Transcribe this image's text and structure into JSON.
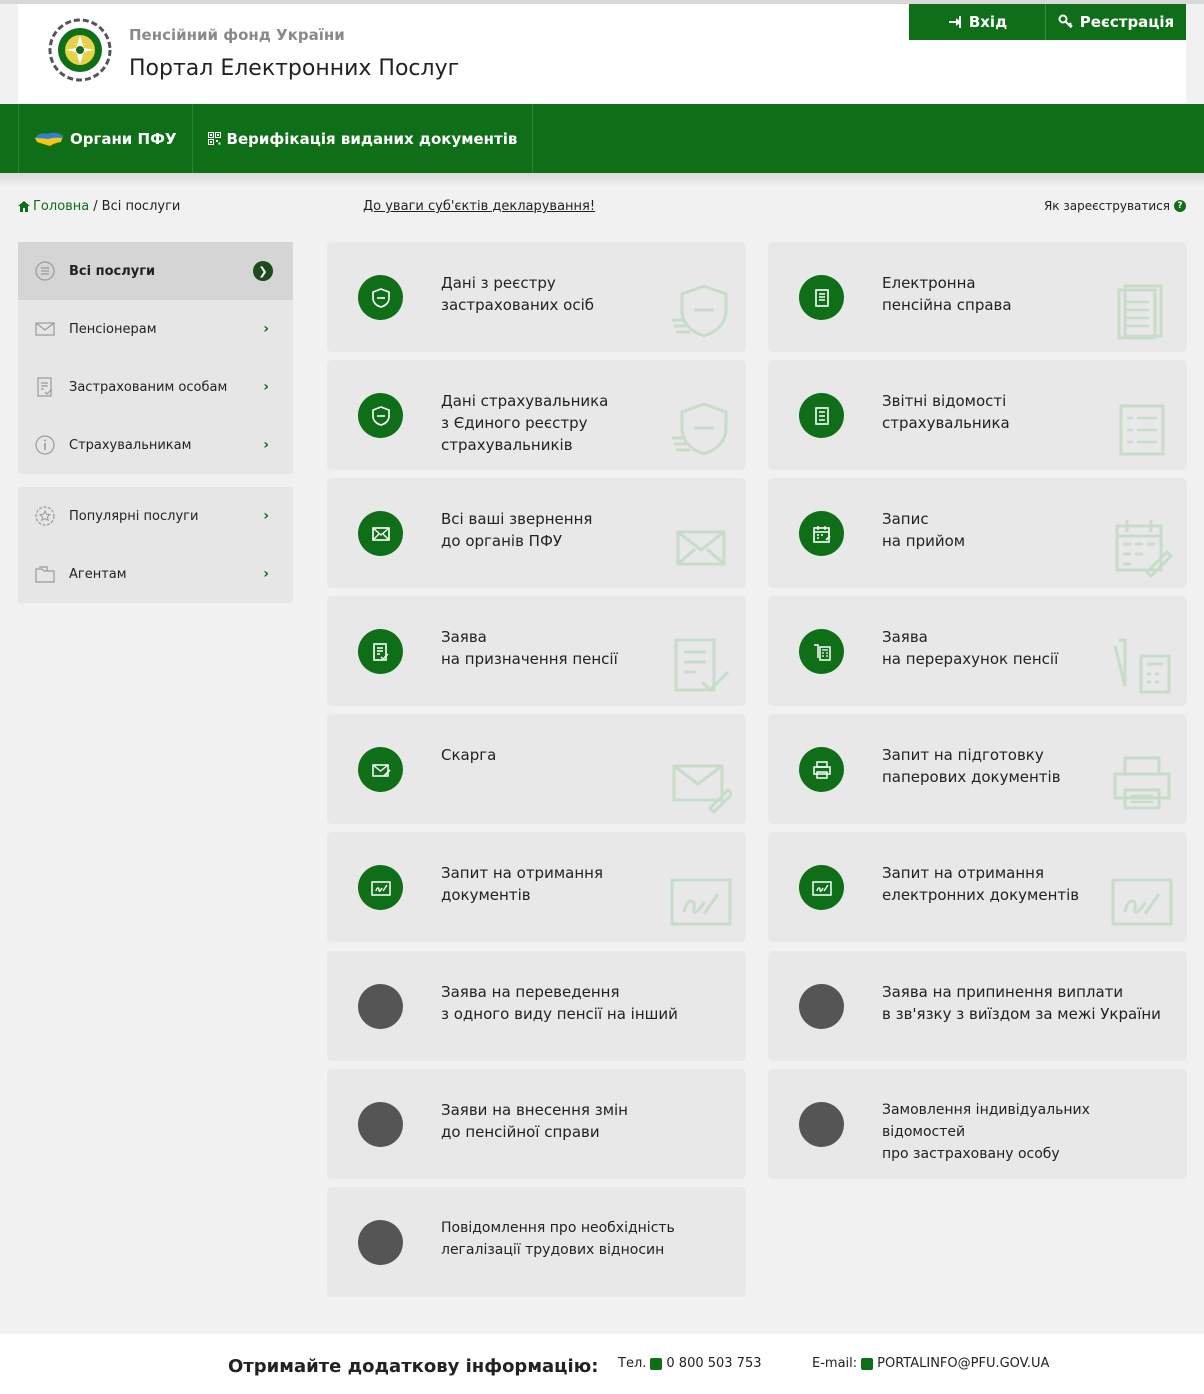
{
  "header": {
    "org_name": "Пенсійний фонд України",
    "portal_name": "Портал Електронних Послуг",
    "login_label": "Вхід",
    "register_label": "Реєстрація"
  },
  "nav": {
    "items": [
      {
        "label": "Органи ПФУ",
        "icon": "ukraine-map-icon"
      },
      {
        "label": "Верифікація виданих документів",
        "icon": "qr-code-icon"
      }
    ]
  },
  "breadcrumb": {
    "home": "Головна",
    "separator": "/",
    "current": "Всі послуги"
  },
  "notice_link": "До уваги суб'єктів декларування!",
  "how_register": "Як зареєструватися",
  "sidebar": {
    "group1": [
      {
        "label": "Всі послуги",
        "icon": "list-icon",
        "active": true
      },
      {
        "label": "Пенсіонерам",
        "icon": "envelope-icon"
      },
      {
        "label": "Застрахованим особам",
        "icon": "document-check-icon"
      },
      {
        "label": "Страхувальникам",
        "icon": "info-icon"
      }
    ],
    "group2": [
      {
        "label": "Популярні послуги",
        "icon": "star-badge-icon"
      },
      {
        "label": "Агентам",
        "icon": "folder-icon"
      }
    ]
  },
  "cards": [
    {
      "title": "Дані з реєстру\nзастрахованих осіб",
      "icon": "shield-icon",
      "color": "green"
    },
    {
      "title": "Електронна\nпенсійна справа",
      "icon": "binder-icon",
      "color": "green"
    },
    {
      "title": "Дані страхувальника\nз Єдиного реєстру\nстрахувальників",
      "icon": "shield-icon",
      "color": "green"
    },
    {
      "title": "Звітні відомості\nстрахувальника",
      "icon": "report-icon",
      "color": "green"
    },
    {
      "title": "Всі ваші звернення\nдо органів ПФУ",
      "icon": "envelope-icon",
      "color": "green"
    },
    {
      "title": "Запис\nна прийом",
      "icon": "calendar-icon",
      "color": "green"
    },
    {
      "title": "Заява\nна призначення пенсії",
      "icon": "document-check-icon",
      "color": "green"
    },
    {
      "title": "Заява\nна перерахунок пенсії",
      "icon": "calculator-icon",
      "color": "green"
    },
    {
      "title": "Скарга",
      "icon": "envelope-pen-icon",
      "color": "green"
    },
    {
      "title": "Запит на підготовку\nпаперових документів",
      "icon": "printer-icon",
      "color": "green"
    },
    {
      "title": "Запит на отримання\nдокументів",
      "icon": "signature-icon",
      "color": "green"
    },
    {
      "title": "Запит на отримання\nелектронних документів",
      "icon": "signature-icon",
      "color": "green"
    },
    {
      "title": "Заява на переведення\nз одного виду пенсії на інший",
      "icon": "",
      "color": "gray"
    },
    {
      "title": "Заява на припинення виплати\nв зв'язку з виїздом за межі України",
      "icon": "",
      "color": "gray"
    },
    {
      "title": "Заяви на внесення змін\nдо пенсійної справи",
      "icon": "",
      "color": "gray"
    },
    {
      "title": "Замовлення індивідуальних відомостей\nпро застраховану особу",
      "icon": "",
      "color": "gray"
    },
    {
      "title": "Повідомлення про необхідність\nлегалізації трудових відносин",
      "icon": "",
      "color": "gray"
    }
  ],
  "footer": {
    "title": "Отримайте додаткову інформацію:",
    "phone_label": "Тел.",
    "phone": "0 800 503 753",
    "email_label": "E-mail:",
    "email": "PORTALINFO@PFU.GOV.UA"
  },
  "colors": {
    "brand_green": "#0f6e18",
    "disabled_circle": "#555555"
  }
}
